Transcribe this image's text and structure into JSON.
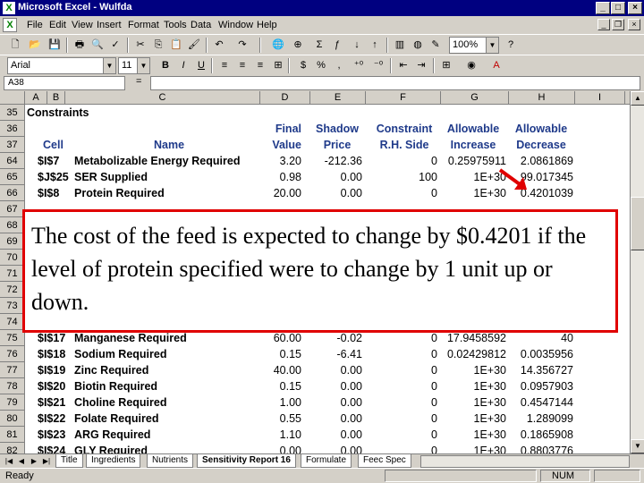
{
  "window": {
    "title": "Microsoft Excel - Wulfda",
    "min": "_",
    "max": "□",
    "close": "×"
  },
  "menus": [
    "File",
    "Edit",
    "View",
    "Insert",
    "Format",
    "Tools",
    "Data",
    "Window",
    "Help"
  ],
  "toolbar": {
    "zoom": "100%"
  },
  "format_toolbar": {
    "font": "Arial",
    "size": "11",
    "bold": "B",
    "italic": "I",
    "underline": "U",
    "currency": "$",
    "percent": "%"
  },
  "formula_bar": {
    "name_box": "A38",
    "eq": "="
  },
  "columns": [
    {
      "label": "A"
    },
    {
      "label": "B"
    },
    {
      "label": "C"
    },
    {
      "label": "D"
    },
    {
      "label": "E"
    },
    {
      "label": "F"
    },
    {
      "label": "G"
    },
    {
      "label": "H"
    },
    {
      "label": "I"
    },
    {
      "label": "J"
    }
  ],
  "section_title": "Constraints",
  "headers": {
    "cell": "Cell",
    "name": "Name",
    "final1": "Final",
    "final2": "Value",
    "shadow1": "Shadow",
    "shadow2": "Price",
    "constraint1": "Constraint",
    "constraint2": "R.H. Side",
    "allowinc1": "Allowable",
    "allowinc2": "Increase",
    "allowdec1": "Allowable",
    "allowdec2": "Decrease"
  },
  "row_numbers": [
    "35",
    "36",
    "37",
    "64",
    "65",
    "66",
    "67",
    "68",
    "69",
    "70",
    "71",
    "72",
    "73",
    "74",
    "75",
    "76",
    "77",
    "78",
    "79",
    "80",
    "81",
    "82"
  ],
  "rows": [
    {
      "cell": "$I$7",
      "name": "Metabolizable Energy Required",
      "final": "3.20",
      "shadow": "-212.36",
      "rhs": "0",
      "inc": "0.25975911",
      "dec": "2.0861869"
    },
    {
      "cell": "$J$25",
      "name": "SER Supplied",
      "final": "0.98",
      "shadow": "0.00",
      "rhs": "100",
      "inc": "1E+30",
      "dec": "99.017345"
    },
    {
      "cell": "$I$8",
      "name": "Protein Required",
      "final": "20.00",
      "shadow": "0.00",
      "rhs": "0",
      "inc": "1E+30",
      "dec": "0.4201039"
    },
    {
      "cell": "$I$17",
      "name": "Manganese Required",
      "final": "60.00",
      "shadow": "-0.02",
      "rhs": "0",
      "inc": "17.9458592",
      "dec": "40"
    },
    {
      "cell": "$I$18",
      "name": "Sodium Required",
      "final": "0.15",
      "shadow": "-6.41",
      "rhs": "0",
      "inc": "0.02429812",
      "dec": "0.0035956"
    },
    {
      "cell": "$I$19",
      "name": "Zinc Required",
      "final": "40.00",
      "shadow": "0.00",
      "rhs": "0",
      "inc": "1E+30",
      "dec": "14.356727"
    },
    {
      "cell": "$I$20",
      "name": "Biotin Required",
      "final": "0.15",
      "shadow": "0.00",
      "rhs": "0",
      "inc": "1E+30",
      "dec": "0.0957903"
    },
    {
      "cell": "$I$21",
      "name": "Choline Required",
      "final": "1.00",
      "shadow": "0.00",
      "rhs": "0",
      "inc": "1E+30",
      "dec": "0.4547144"
    },
    {
      "cell": "$I$22",
      "name": "Folate Required",
      "final": "0.55",
      "shadow": "0.00",
      "rhs": "0",
      "inc": "1E+30",
      "dec": "1.289099"
    },
    {
      "cell": "$I$23",
      "name": "ARG Required",
      "final": "1.10",
      "shadow": "0.00",
      "rhs": "0",
      "inc": "1E+30",
      "dec": "0.1865908"
    },
    {
      "cell": "$I$24",
      "name": "GLY Required",
      "final": "0.00",
      "shadow": "0.00",
      "rhs": "0",
      "inc": "1E+30",
      "dec": "0.8803776"
    }
  ],
  "callout": "The cost of the feed is expected to change by $0.4201 if the level of protein specified were to change by 1 unit up or down.",
  "sheet_tabs": [
    "Title",
    "Ingredients",
    "Nutrients",
    "Sensitivity Report 16",
    "Formulate",
    "Feec Spec"
  ],
  "active_tab": "Sensitivity Report 16",
  "status": {
    "ready": "Ready",
    "num": "NUM"
  },
  "colors": {
    "title_bg": "#000080",
    "callout_border": "#e00000",
    "header_text": "#1f3a8a",
    "arrow": "#e00000"
  }
}
